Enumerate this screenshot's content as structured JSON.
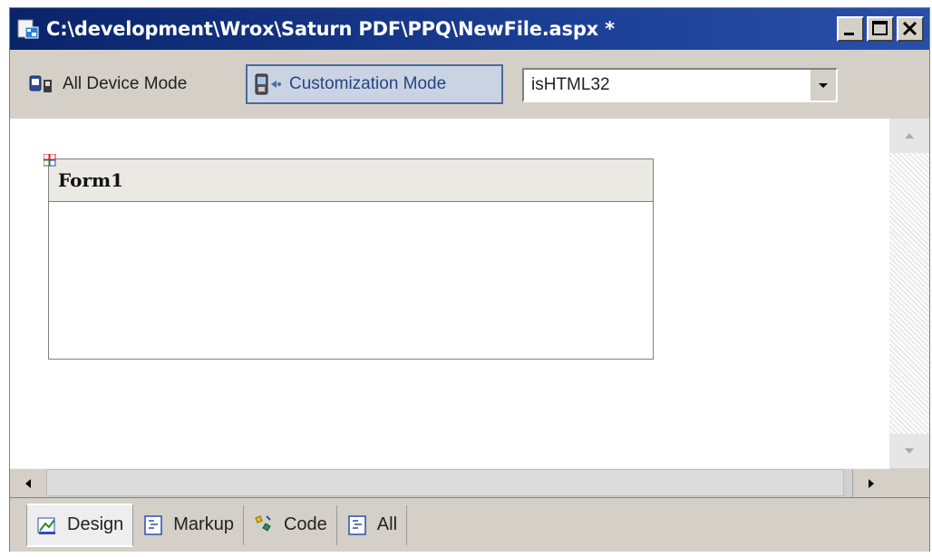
{
  "window": {
    "title": "C:\\development\\Wrox\\Saturn PDF\\PPQ\\NewFile.aspx *",
    "buttons": [
      "minimize-icon",
      "maximize-icon",
      "close-icon"
    ]
  },
  "toolbar": {
    "all_device_mode": "All Device Mode",
    "customization_mode": "Customization Mode",
    "device_filter_value": "isHTML32"
  },
  "designer": {
    "form_title": "Form1"
  },
  "tabs": [
    {
      "label": "Design",
      "icon": "design-view-icon",
      "active": true
    },
    {
      "label": "Markup",
      "icon": "markup-view-icon",
      "active": false
    },
    {
      "label": "Code",
      "icon": "code-view-icon",
      "active": false
    },
    {
      "label": "All",
      "icon": "all-view-icon",
      "active": false
    }
  ],
  "colors": {
    "titlebar": "#0a246a",
    "chrome": "#d4d0c8",
    "highlight_mode": "#c9d3e4"
  }
}
